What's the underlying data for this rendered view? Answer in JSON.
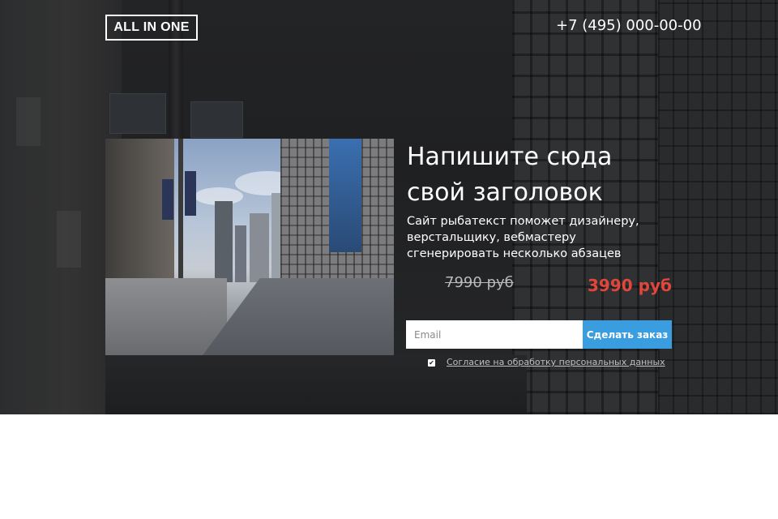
{
  "header": {
    "logo_text": "ALL IN ONE",
    "phone": "+7 (495) 000-00-00"
  },
  "offer": {
    "headline_line1": "Напишите сюда",
    "headline_line2": "свой заголовок",
    "description": "Сайт рыбатекст поможет дизайнеру, верстальщику, вебмастеру сгенерировать несколько абзацев",
    "price_old": "7990 руб",
    "price_new": "3990 руб"
  },
  "form": {
    "email_placeholder": "Email",
    "submit_label": "Сделать заказ",
    "consent_checked_glyph": "✔",
    "consent_label": "Согласие на обработку персональных данных"
  },
  "colors": {
    "accent_button": "#3a9de0",
    "price_new": "#e0463b"
  }
}
